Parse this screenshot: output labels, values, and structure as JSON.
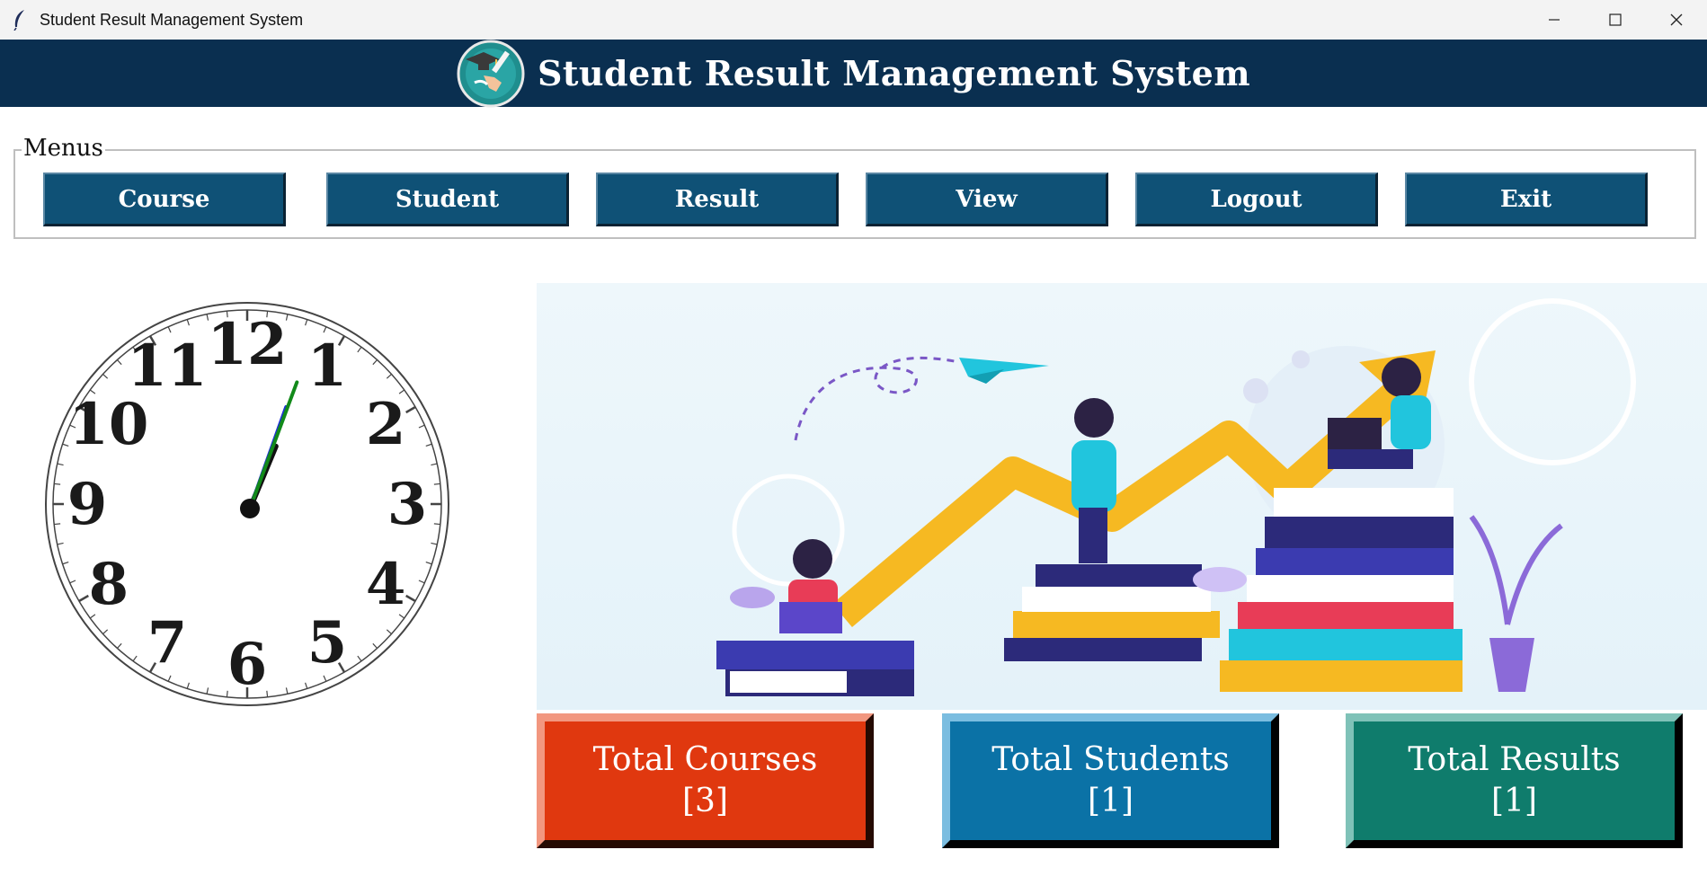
{
  "window": {
    "title": "Student Result Management System",
    "minimize_icon": "minimize-icon",
    "maximize_icon": "maximize-icon",
    "close_icon": "close-icon"
  },
  "header": {
    "title": "Student Result Management System",
    "logo_icon": "graduation-logo-icon",
    "background": "#0a2f50"
  },
  "menu": {
    "legend": "Menus",
    "buttons": [
      {
        "label": "Course"
      },
      {
        "label": "Student"
      },
      {
        "label": "Result"
      },
      {
        "label": "View"
      },
      {
        "label": "Logout"
      },
      {
        "label": "Exit"
      }
    ],
    "button_color": "#0f5176"
  },
  "clock": {
    "numerals": [
      "12",
      "1",
      "2",
      "3",
      "4",
      "5",
      "6",
      "7",
      "8",
      "9",
      "10",
      "11"
    ],
    "time": {
      "hour": 0,
      "minute": 2,
      "second": 4
    }
  },
  "stats": {
    "courses": {
      "label": "Total Courses",
      "value": "[3]",
      "color": "#e0380f"
    },
    "students": {
      "label": "Total Students",
      "value": "[1]",
      "color": "#0b72a6"
    },
    "results": {
      "label": "Total Results",
      "value": "[1]",
      "color": "#0f7c6c"
    }
  }
}
